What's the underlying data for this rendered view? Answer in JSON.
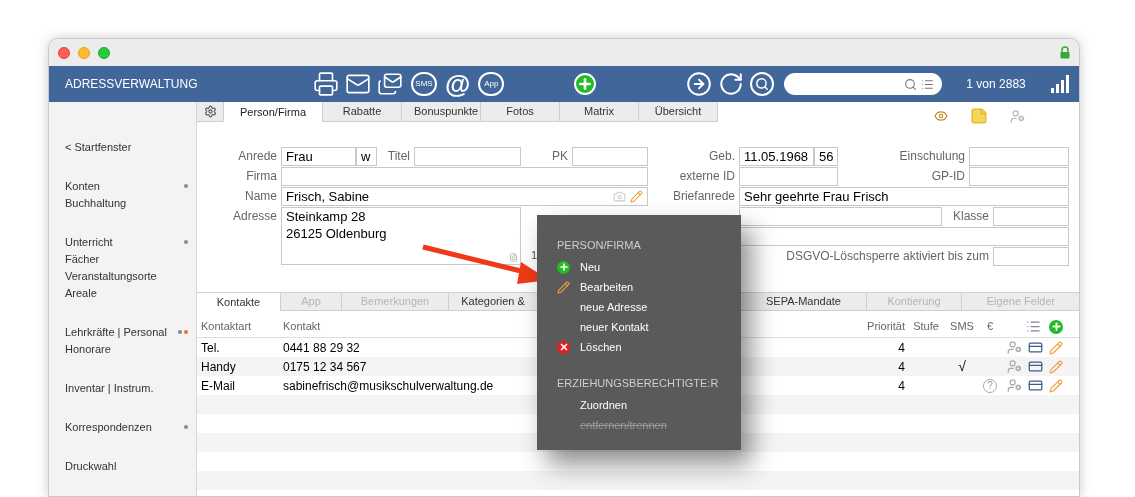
{
  "window": {
    "title": "ADRESSVERWALTUNG"
  },
  "toolbar": [
    {
      "kind": "print"
    },
    {
      "kind": "mail"
    },
    {
      "kind": "mails"
    },
    {
      "kind": "bubble",
      "label": "SMS"
    },
    {
      "kind": "at",
      "label": "@"
    },
    {
      "kind": "bubble",
      "label": "App"
    },
    {
      "kind": "add"
    },
    {
      "kind": "forward"
    },
    {
      "kind": "refresh"
    },
    {
      "kind": "find"
    }
  ],
  "record_counter": "1 von 2883",
  "sidebar": {
    "back": "< Startfenster",
    "groups": [
      {
        "items": [
          {
            "label": "Konten",
            "dots": [
              {
                "color": "#8a8a8a"
              }
            ]
          },
          {
            "label": "Buchhaltung"
          }
        ]
      },
      {
        "items": [
          {
            "label": "Unterricht",
            "dots": [
              {
                "color": "#8a8a8a"
              }
            ]
          },
          {
            "label": "Fächer"
          },
          {
            "label": "Veranstaltungsorte"
          },
          {
            "label": "Areale"
          }
        ]
      },
      {
        "items": [
          {
            "label": "Lehrkräfte | Personal",
            "dots": [
              {
                "color": "#8a8a8a"
              },
              {
                "color": "#f07030"
              }
            ]
          },
          {
            "label": "Honorare"
          }
        ]
      },
      {
        "items": [
          {
            "label": "Inventar | Instrum."
          }
        ]
      },
      {
        "items": [
          {
            "label": "Korrespondenzen",
            "dots": [
              {
                "color": "#8a8a8a"
              }
            ]
          }
        ]
      },
      {
        "items": [
          {
            "label": "Druckwahl"
          }
        ]
      }
    ]
  },
  "tabs": [
    {
      "label": "Person/Firma",
      "selected": true
    },
    {
      "label": "Rabatte",
      "selected": false
    },
    {
      "label": "Bonuspunkte",
      "selected": false
    },
    {
      "label": "Fotos",
      "selected": false
    },
    {
      "label": "Matrix",
      "selected": false
    },
    {
      "label": "Übersicht",
      "selected": false
    }
  ],
  "form": {
    "anrede": {
      "label": "Anrede",
      "value": "Frau",
      "gender": "w"
    },
    "titel": {
      "label": "Titel"
    },
    "pk": {
      "label": "PK"
    },
    "firma": {
      "label": "Firma"
    },
    "name": {
      "label": "Name",
      "value": "Frisch, Sabine"
    },
    "adresse": {
      "label": "Adresse",
      "lines": [
        "Steinkamp 28",
        "26125 Oldenburg"
      ]
    },
    "contract_cut": "1",
    "geb": {
      "label": "Geb.",
      "value": "11.05.1968",
      "age": "56"
    },
    "einschulung": {
      "label": "Einschulung"
    },
    "externe_id": {
      "label": "externe ID"
    },
    "gp_id": {
      "label": "GP-ID"
    },
    "briefanrede": {
      "label": "Briefanrede",
      "value": "Sehr geehrte Frau Frisch"
    },
    "klasse": {
      "label": "Klasse"
    },
    "dsgvo": {
      "label": "DSGVO-Löschsperre aktiviert bis zum"
    }
  },
  "lower_tabs": [
    {
      "label": "Kontakte",
      "selected": true,
      "disabled": false
    },
    {
      "label": "App",
      "selected": false,
      "disabled": true
    },
    {
      "label": "Bemerkungen",
      "selected": false,
      "disabled": true
    },
    {
      "label": "Kategorien &",
      "selected": false,
      "disabled": false
    },
    {
      "label": "SEPA-Mandate",
      "selected": false,
      "disabled": false
    },
    {
      "label": "Kontierung",
      "selected": false,
      "disabled": true
    },
    {
      "label": "Eigene Felder",
      "selected": false,
      "disabled": true
    }
  ],
  "contacts": {
    "columns": [
      "Kontaktart",
      "Kontakt",
      "Priorität",
      "Stufe",
      "SMS",
      "€"
    ],
    "rows": [
      {
        "type": "Tel.",
        "contact": "0441 88 29 32",
        "priority": "4",
        "sms": false,
        "unknown": false
      },
      {
        "type": "Handy",
        "contact": "0175 12 34 567",
        "priority": "4",
        "sms": true,
        "unknown": false
      },
      {
        "type": "E-Mail",
        "contact": "sabinefrisch@musikschulverwaltung.de",
        "priority": "4",
        "sms": false,
        "unknown": true
      }
    ],
    "sms_mark": "√",
    "unknown_mark": "?"
  },
  "context_menu": {
    "sections": [
      {
        "title": "PERSON/FIRMA",
        "items": [
          {
            "label": "Neu",
            "kind": "add",
            "disabled": false
          },
          {
            "label": "Bearbeiten",
            "kind": "edit",
            "disabled": false
          },
          {
            "label": "neue Adresse",
            "kind": "plain",
            "disabled": false
          },
          {
            "label": "neuer Kontakt",
            "kind": "plain",
            "disabled": false
          },
          {
            "label": "Löschen",
            "kind": "delete",
            "disabled": false
          }
        ]
      },
      {
        "title": "ERZIEHUNGSBERECHTIGTE:R",
        "items": [
          {
            "label": "Zuordnen",
            "kind": "plain",
            "disabled": false
          },
          {
            "label": "entfernen/trennen",
            "kind": "plain",
            "disabled": true
          }
        ]
      }
    ]
  }
}
